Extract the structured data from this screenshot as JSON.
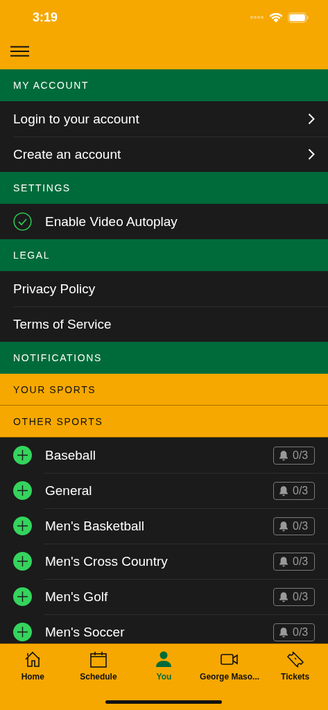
{
  "status_bar": {
    "time": "3:19"
  },
  "sections": [
    {
      "title": "MY ACCOUNT",
      "kind": "group",
      "items": [
        {
          "kind": "link",
          "label": "Login to your account"
        },
        {
          "kind": "link",
          "label": "Create an account"
        }
      ]
    },
    {
      "title": "SETTINGS",
      "kind": "group",
      "items": [
        {
          "kind": "toggle",
          "label": "Enable Video Autoplay",
          "checked": true
        }
      ]
    },
    {
      "title": "LEGAL",
      "kind": "group",
      "items": [
        {
          "kind": "plain",
          "label": "Privacy Policy"
        },
        {
          "kind": "plain",
          "label": "Terms of Service"
        }
      ]
    },
    {
      "title": "NOTIFICATIONS",
      "kind": "group"
    },
    {
      "title": "YOUR SPORTS",
      "kind": "subgroup"
    },
    {
      "title": "OTHER SPORTS",
      "kind": "subgroup",
      "items": [
        {
          "kind": "sport",
          "label": "Baseball",
          "count": "0/3"
        },
        {
          "kind": "sport",
          "label": "General",
          "count": "0/3"
        },
        {
          "kind": "sport",
          "label": "Men's Basketball",
          "count": "0/3"
        },
        {
          "kind": "sport",
          "label": "Men's Cross Country",
          "count": "0/3"
        },
        {
          "kind": "sport",
          "label": "Men's Golf",
          "count": "0/3"
        },
        {
          "kind": "sport",
          "label": "Men's Soccer",
          "count": "0/3"
        }
      ]
    }
  ],
  "tabs": [
    {
      "label": "Home",
      "selected": false
    },
    {
      "label": "Schedule",
      "selected": false
    },
    {
      "label": "You",
      "selected": true
    },
    {
      "label": "George Maso...",
      "selected": false
    },
    {
      "label": "Tickets",
      "selected": false
    }
  ]
}
